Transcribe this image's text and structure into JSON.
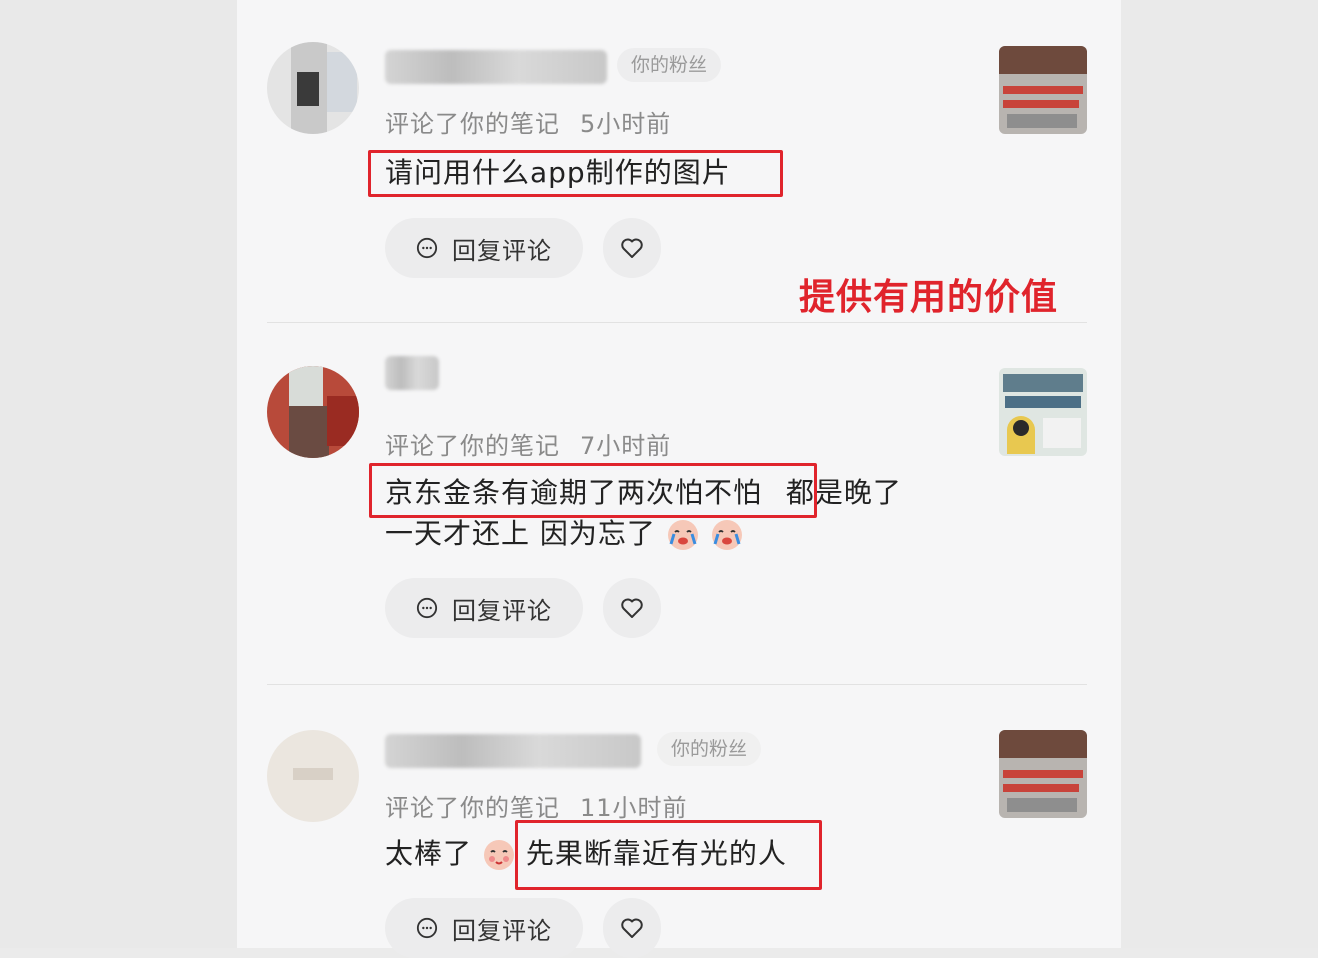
{
  "fan_badge": "你的粉丝",
  "reply_label": "回复评论",
  "annotation": "提供有用的价值",
  "comments": [
    {
      "action": "评论了你的笔记",
      "time": "5小时前",
      "highlight": "请问用什么app制作的图片",
      "extra_line1": "",
      "extra_line2": ""
    },
    {
      "action": "评论了你的笔记",
      "time": "7小时前",
      "highlight": "京东金条有逾期了两次怕不怕",
      "extra_line1": "都是晚了",
      "extra_line2": "一天才还上  因为忘了"
    },
    {
      "action": "评论了你的笔记",
      "time": "11小时前",
      "prefix": "太棒了",
      "highlight": "先果断靠近有光的人"
    }
  ],
  "colors": {
    "accent_red": "#e0242c",
    "panel_bg": "#f6f6f7",
    "button_bg": "#ececed"
  },
  "icons": [
    "comment-bubble-icon",
    "heart-icon",
    "crying-face-emoji",
    "blushing-face-emoji"
  ]
}
